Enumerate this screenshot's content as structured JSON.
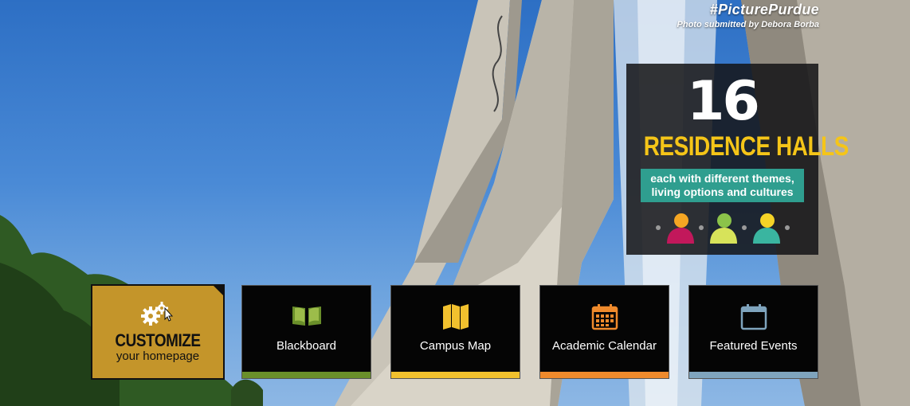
{
  "hero": {
    "hashtag": "#PicturePurdue",
    "credit": "Photo submitted by Debora Borba"
  },
  "promo": {
    "number": "16",
    "title": "RESIDENCE HALLS",
    "subtitle_line1": "each with different themes,",
    "subtitle_line2": "living options and cultures"
  },
  "customize": {
    "title": "CUSTOMIZE",
    "subtitle": "your homepage",
    "color": "#c4952a"
  },
  "tiles": [
    {
      "label": "Blackboard",
      "icon": "book-icon",
      "color": "#6a8f2a"
    },
    {
      "label": "Campus Map",
      "icon": "map-icon",
      "color": "#f2c12e"
    },
    {
      "label": "Academic Calendar",
      "icon": "calendar-icon",
      "color": "#ef8a2c"
    },
    {
      "label": "Featured Events",
      "icon": "calendar-blank-icon",
      "color": "#7fa4bd"
    }
  ]
}
